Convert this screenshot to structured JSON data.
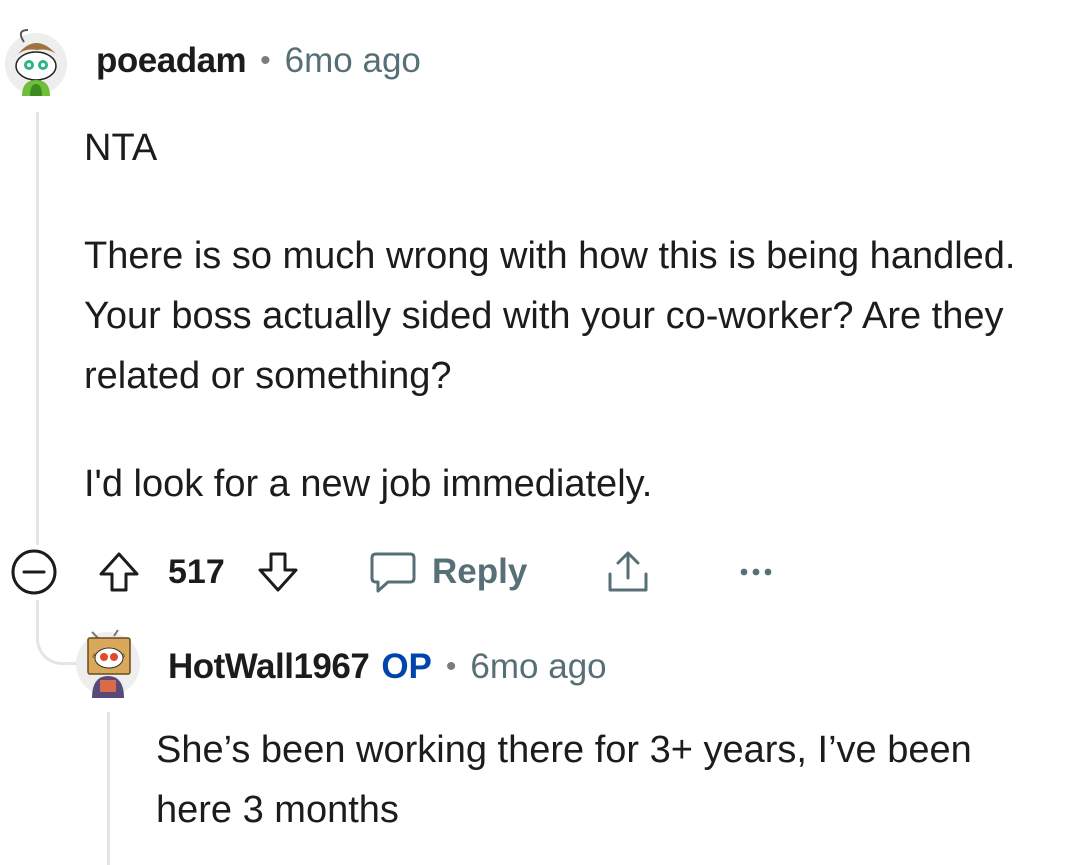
{
  "comment": {
    "author": "poeadam",
    "separator": "•",
    "time": "6mo ago",
    "paragraphs": [
      "NTA",
      "There is so much wrong with how this is being handled. Your boss actually sided with your co-worker? Are they related or something?",
      "I'd look for a new job immediately."
    ],
    "score": "517",
    "reply_label": "Reply",
    "icons": {
      "collapse": "collapse-minus-icon",
      "upvote": "upvote-arrow-icon",
      "downvote": "downvote-arrow-icon",
      "reply": "speech-bubble-icon",
      "share": "share-icon",
      "more": "more-dots-icon"
    }
  },
  "reply": {
    "author": "HotWall1967",
    "badge": "OP",
    "separator": "•",
    "time": "6mo ago",
    "paragraphs": [
      "She’s been working there for 3+ years, I’ve been here 3 months"
    ]
  },
  "colors": {
    "op_badge": "#0045ac",
    "meta_gray": "#576f76",
    "thread_line": "#e5e5e5"
  }
}
